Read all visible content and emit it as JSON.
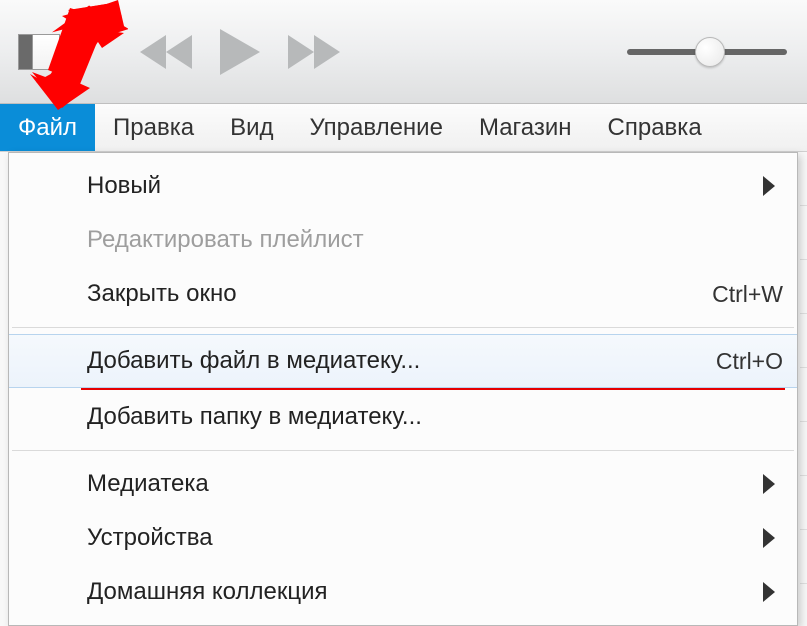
{
  "menubar": {
    "items": [
      {
        "label": "Файл",
        "active": true
      },
      {
        "label": "Правка",
        "active": false
      },
      {
        "label": "Вид",
        "active": false
      },
      {
        "label": "Управление",
        "active": false
      },
      {
        "label": "Магазин",
        "active": false
      },
      {
        "label": "Справка",
        "active": false
      }
    ]
  },
  "dropdown": {
    "new": "Новый",
    "edit_playlist": "Редактировать плейлист",
    "close_window": {
      "label": "Закрыть окно",
      "shortcut": "Ctrl+W"
    },
    "add_file": {
      "label": "Добавить файл в медиатеку...",
      "shortcut": "Ctrl+O"
    },
    "add_folder": "Добавить папку в медиатеку...",
    "library": "Медиатека",
    "devices": "Устройства",
    "home_sharing": "Домашняя коллекция"
  },
  "icons": {
    "prev": "previous-icon",
    "play": "play-icon",
    "next": "next-icon"
  },
  "volume": {
    "value": 45
  }
}
